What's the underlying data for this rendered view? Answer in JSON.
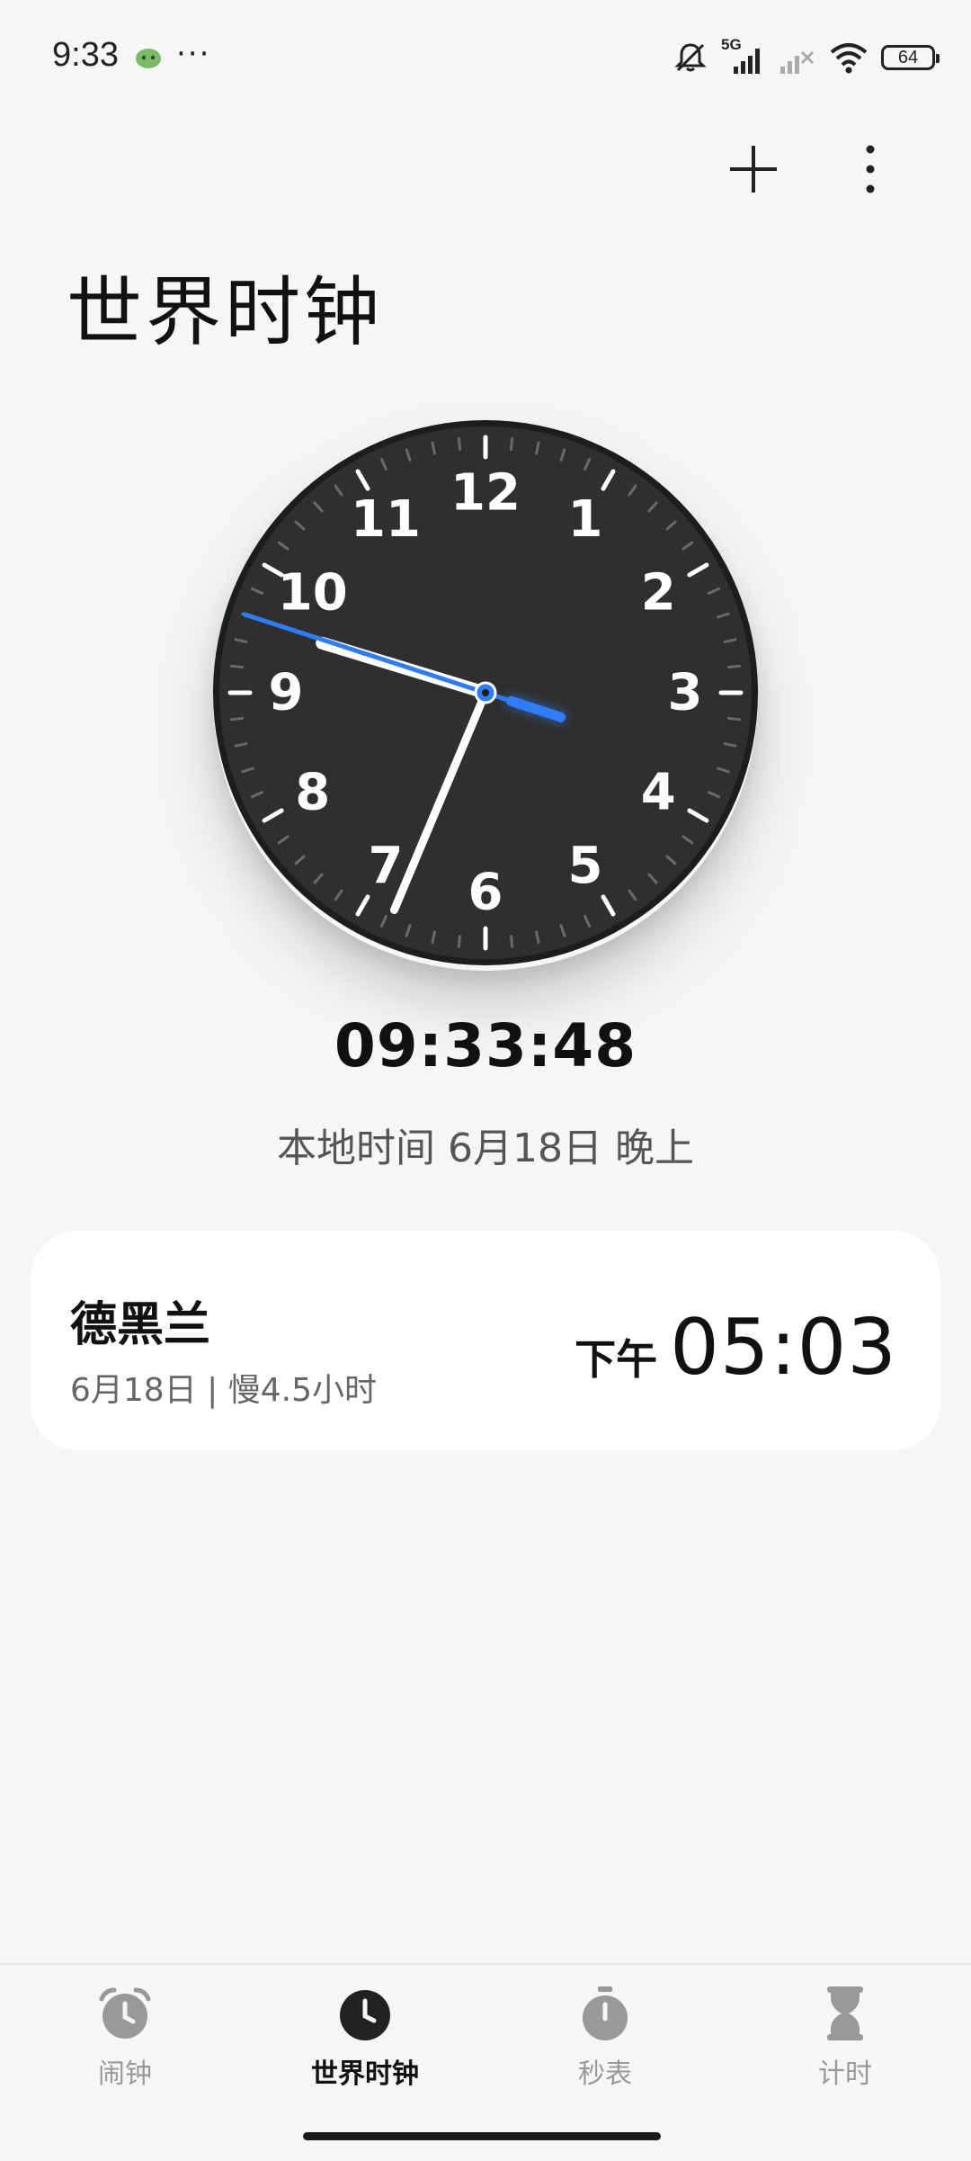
{
  "status_bar": {
    "time": "9:33",
    "more": "···",
    "network": "5G",
    "battery": "64"
  },
  "page": {
    "title": "世界时钟"
  },
  "clock": {
    "numerals": [
      "12",
      "1",
      "2",
      "3",
      "4",
      "5",
      "6",
      "7",
      "8",
      "9",
      "10",
      "11"
    ],
    "hours": 9,
    "minutes": 33,
    "seconds": 48,
    "face_color": "#2f2f2f",
    "second_hand_color": "#2f7cf6"
  },
  "local": {
    "digital_time": "09:33:48",
    "date_text": "本地时间 6月18日 晚上"
  },
  "cities": [
    {
      "name": "德黑兰",
      "subtitle": "6月18日 | 慢4.5小时",
      "ampm": "下午",
      "time": "05:03"
    }
  ],
  "nav": {
    "items": [
      {
        "label": "闹钟",
        "icon": "alarm-clock-icon",
        "active": false
      },
      {
        "label": "世界时钟",
        "icon": "clock-icon",
        "active": true
      },
      {
        "label": "秒表",
        "icon": "stopwatch-icon",
        "active": false
      },
      {
        "label": "计时",
        "icon": "hourglass-icon",
        "active": false
      }
    ]
  },
  "colors": {
    "background": "#f6f6f6",
    "card": "#ffffff",
    "accent": "#2f7cf6",
    "inactive": "#999999"
  }
}
